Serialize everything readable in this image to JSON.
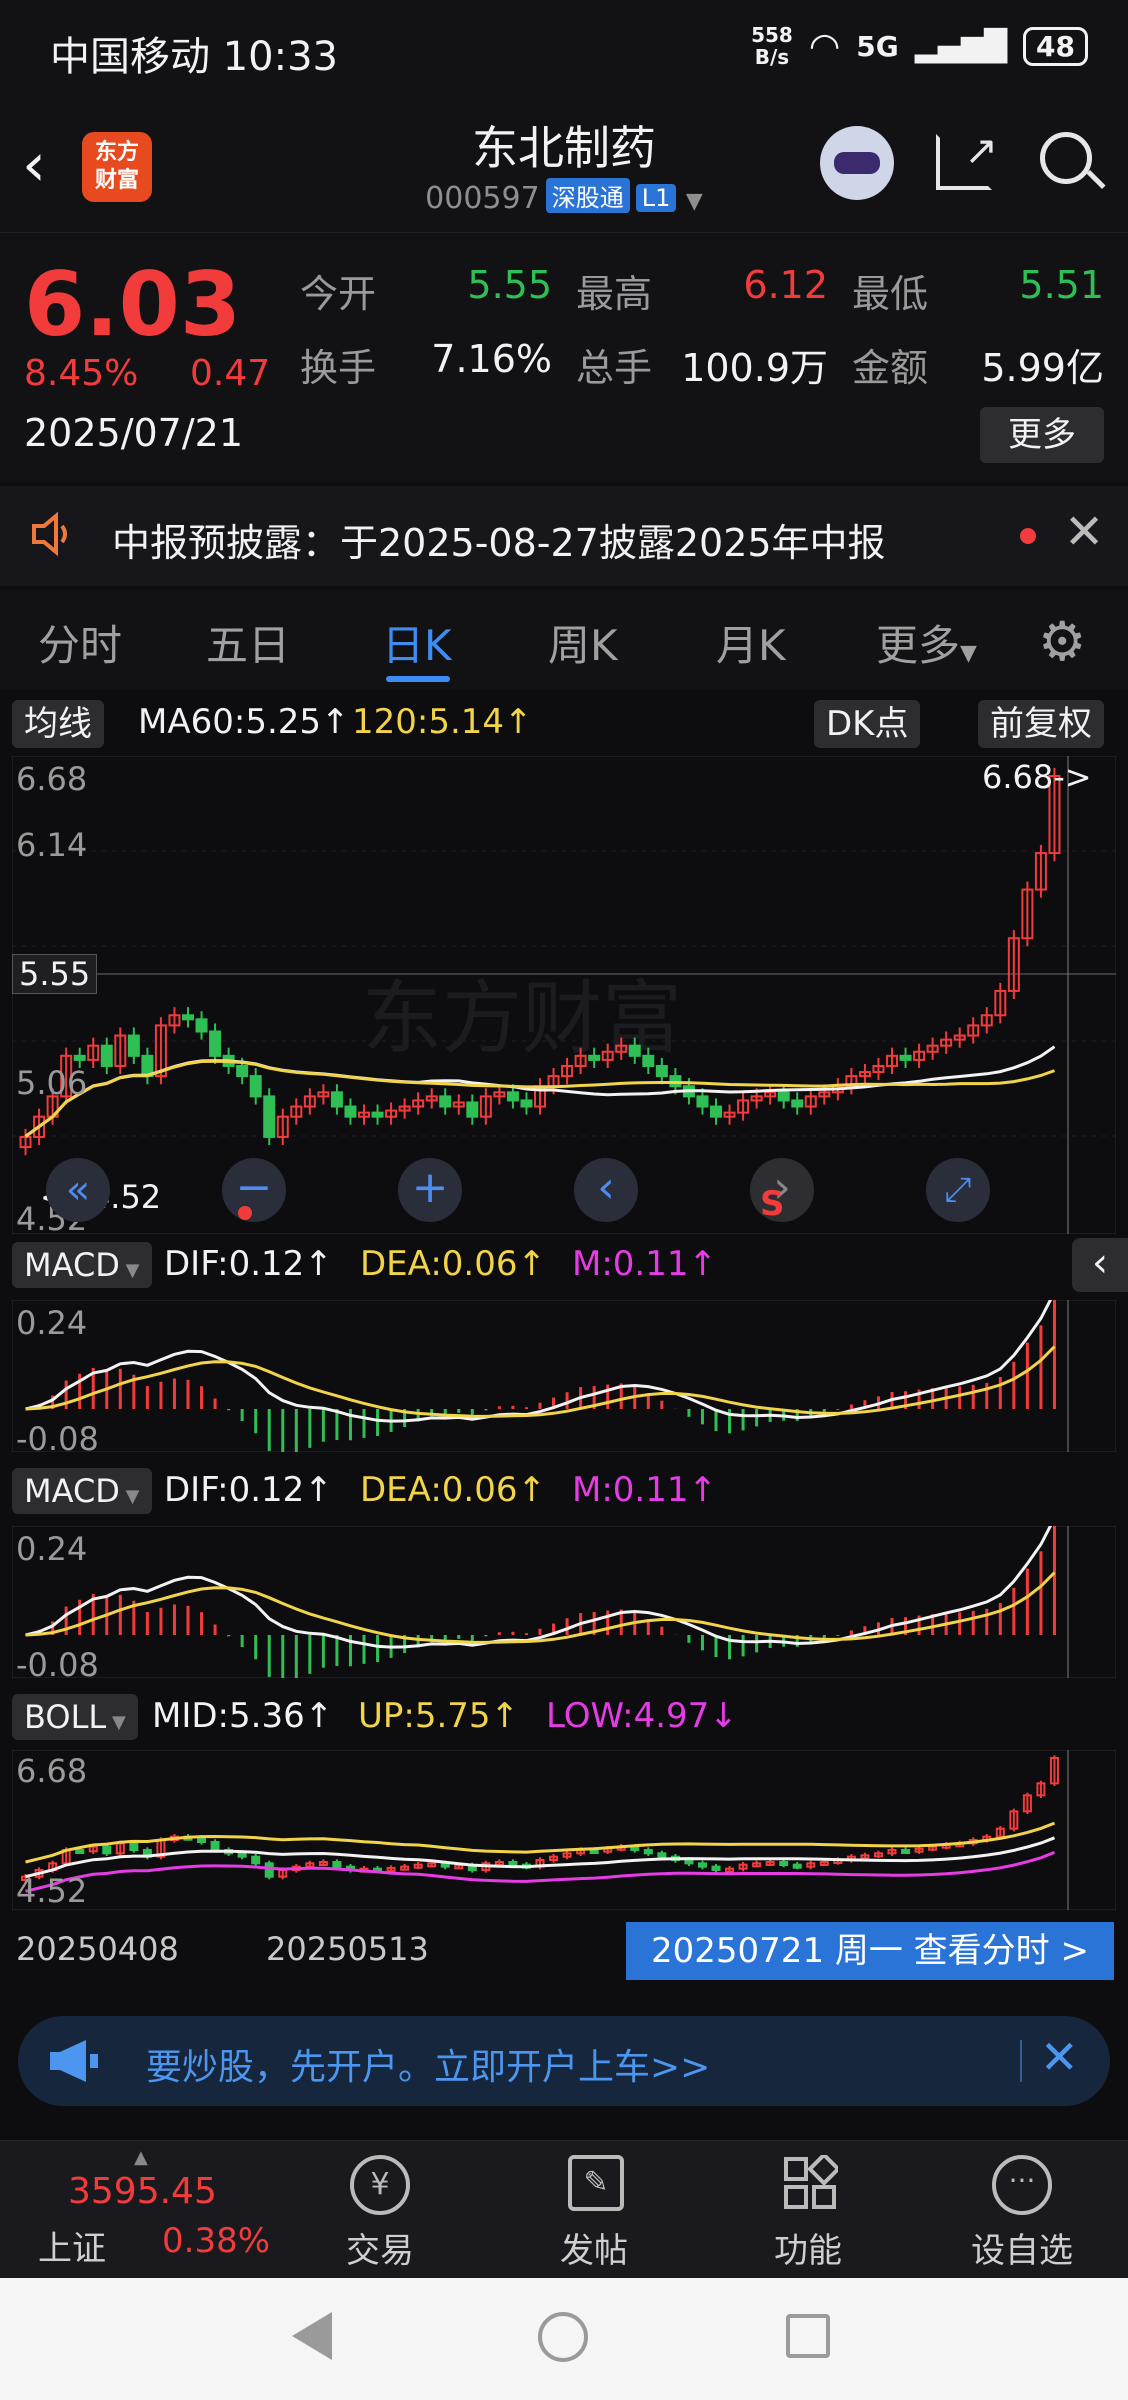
{
  "status": {
    "carrier_time": "中国移动 10:33",
    "speed_top": "558",
    "speed_bottom": "B/s",
    "net": "5G",
    "battery": "48"
  },
  "header": {
    "logo_top": "东方",
    "logo_bottom": "财富",
    "title": "东北制药",
    "code": "000597",
    "tag1": "深股通",
    "tag2": "L1"
  },
  "quote": {
    "price": "6.03",
    "pct": "8.45%",
    "chg": "0.47",
    "date": "2025/07/21",
    "open_label": "今开",
    "open": "5.55",
    "high_label": "最高",
    "high": "6.12",
    "low_label": "最低",
    "low": "5.51",
    "turnover_label": "换手",
    "turnover": "7.16%",
    "volume_label": "总手",
    "volume": "100.9万",
    "amount_label": "金额",
    "amount": "5.99亿",
    "more": "更多"
  },
  "notice": {
    "text": "中报预披露：于2025-08-27披露2025年中报"
  },
  "tabs": [
    "分时",
    "五日",
    "日K",
    "周K",
    "月K",
    "更多"
  ],
  "main": {
    "indicator": "均线",
    "ma60": "MA60:5.25↑",
    "ma120": "120:5.14↑",
    "dk": "DK点",
    "fq": "前复权",
    "y_top": "6.68",
    "y2": "6.14",
    "y_mid": "5.55",
    "y4": "5.06",
    "y_bottom": "4.52",
    "max_label": "6.68->",
    "min_label": "<--4.52"
  },
  "macd1": {
    "name": "MACD",
    "dif": "DIF:0.12↑",
    "dea": "DEA:0.06↑",
    "m": "M:0.11↑",
    "y_top": "0.24",
    "y_bottom": "-0.08"
  },
  "macd2": {
    "name": "MACD",
    "dif": "DIF:0.12↑",
    "dea": "DEA:0.06↑",
    "m": "M:0.11↑",
    "y_top": "0.24",
    "y_bottom": "-0.08"
  },
  "boll": {
    "name": "BOLL",
    "mid": "MID:5.36↑",
    "up": "UP:5.75↑",
    "low": "LOW:4.97↓",
    "y_top": "6.68",
    "y_bottom": "4.52"
  },
  "xaxis": {
    "d1": "20250408",
    "d2": "20250513",
    "bubble": "20250721 周一 查看分时 >"
  },
  "promo": {
    "text": "要炒股，先开户。立即开户上车>>"
  },
  "bottom": {
    "index_value": "3595.45",
    "index_name": "上证",
    "index_pct": "0.38%",
    "nav": [
      "交易",
      "发帖",
      "功能",
      "设自选"
    ]
  },
  "watermark": "东方财富",
  "colors": {
    "up": "#f23c3c",
    "down": "#2fbf55",
    "accent": "#3d8df2",
    "ma_yellow": "#f1d44a"
  },
  "chart_data": {
    "type": "candlestick",
    "ylim": [
      4.52,
      6.68
    ],
    "closes": [
      4.9,
      5.0,
      5.1,
      5.3,
      5.28,
      5.35,
      5.25,
      5.4,
      5.3,
      5.2,
      5.45,
      5.5,
      5.48,
      5.42,
      5.3,
      5.25,
      5.2,
      5.1,
      4.9,
      5.0,
      5.05,
      5.1,
      5.12,
      5.05,
      5.0,
      5.02,
      5.0,
      5.03,
      5.05,
      5.08,
      5.1,
      5.05,
      5.07,
      5.0,
      5.1,
      5.12,
      5.08,
      5.05,
      5.15,
      5.2,
      5.25,
      5.3,
      5.28,
      5.32,
      5.35,
      5.3,
      5.25,
      5.2,
      5.15,
      5.1,
      5.05,
      5.0,
      5.02,
      5.08,
      5.1,
      5.12,
      5.08,
      5.05,
      5.1,
      5.12,
      5.15,
      5.2,
      5.22,
      5.25,
      5.3,
      5.28,
      5.32,
      5.35,
      5.38,
      5.4,
      5.45,
      5.5,
      5.62,
      5.88,
      6.12,
      6.3,
      6.68
    ]
  }
}
